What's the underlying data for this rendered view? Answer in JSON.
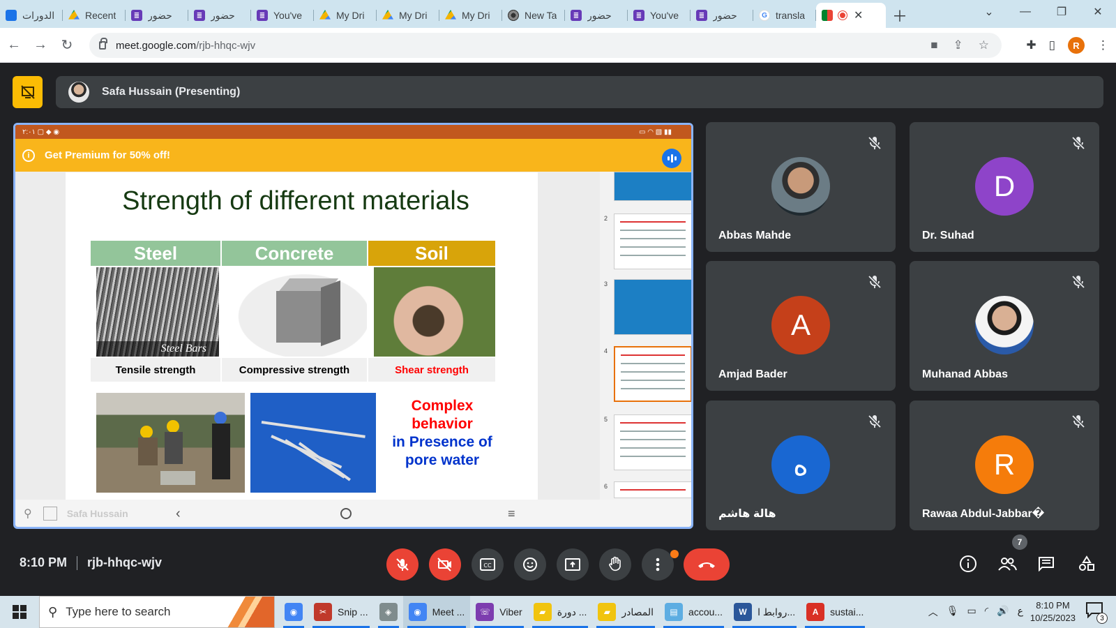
{
  "browser": {
    "tabs": [
      {
        "label": "الدورات",
        "icon": "contacts-icon"
      },
      {
        "label": "Recent",
        "icon": "drive-icon"
      },
      {
        "label": "حضور",
        "icon": "forms-icon"
      },
      {
        "label": "حضور",
        "icon": "forms-icon"
      },
      {
        "label": "You've",
        "icon": "forms-icon"
      },
      {
        "label": "My Dri",
        "icon": "drive-icon"
      },
      {
        "label": "My Dri",
        "icon": "drive-icon"
      },
      {
        "label": "My Dri",
        "icon": "drive-icon"
      },
      {
        "label": "New Ta",
        "icon": "chrome-icon"
      },
      {
        "label": "حضور",
        "icon": "forms-icon"
      },
      {
        "label": "You've",
        "icon": "forms-icon"
      },
      {
        "label": "حضور",
        "icon": "forms-icon"
      },
      {
        "label": "transla",
        "icon": "google-icon"
      }
    ],
    "url_host": "meet.google.com",
    "url_path": "/rjb-hhqc-wjv",
    "profile_initial": "R"
  },
  "meet": {
    "presenter_label": "Safa Hussain (Presenting)",
    "premium_banner": "Get Premium for 50% off!",
    "presenter_watermark": "Safa Hussain",
    "slide": {
      "title": "Strength of different materials",
      "materials": [
        {
          "name": "Steel",
          "strength": "Tensile strength",
          "header_color": "#93c59a",
          "label_color": "#000000",
          "image_caption": "Steel Bars"
        },
        {
          "name": "Concrete",
          "strength": "Compressive strength",
          "header_color": "#93c59a",
          "label_color": "#000000"
        },
        {
          "name": "Soil",
          "strength": "Shear strength",
          "header_color": "#d8a40a",
          "label_color": "#ff0000"
        }
      ],
      "complex_red": "Complex behavior",
      "complex_blue": "in Presence of pore water"
    },
    "thumbnails": [
      {
        "num": "",
        "selected": false
      },
      {
        "num": "2",
        "selected": false
      },
      {
        "num": "3",
        "selected": false
      },
      {
        "num": "4",
        "selected": true
      },
      {
        "num": "5",
        "selected": false
      },
      {
        "num": "6",
        "selected": false
      }
    ],
    "participants": [
      {
        "name": "Abbas Mahde",
        "initial": "",
        "avatar_color": "",
        "photo": "photo1"
      },
      {
        "name": "Dr. Suhad",
        "initial": "D",
        "avatar_color": "#8e44c9",
        "photo": ""
      },
      {
        "name": "Amjad Bader",
        "initial": "A",
        "avatar_color": "#c5401a",
        "photo": ""
      },
      {
        "name": "Muhanad Abbas",
        "initial": "",
        "avatar_color": "",
        "photo": "photo2"
      },
      {
        "name": "هالة هاشم",
        "initial": "ه",
        "avatar_color": "#1967d2",
        "photo": ""
      },
      {
        "name": "Rawaa Abdul-Jabbar�",
        "initial": "R",
        "avatar_color": "#f57c0b",
        "photo": ""
      }
    ],
    "time": "8:10 PM",
    "meeting_code": "rjb-hhqc-wjv",
    "people_count": "7"
  },
  "taskbar": {
    "search_placeholder": "Type here to search",
    "items": [
      {
        "label": "",
        "icon": "chrome-icon",
        "color": "#4285f4"
      },
      {
        "label": "Snip ...",
        "icon": "snip-icon",
        "color": "#c0392b"
      },
      {
        "label": "",
        "icon": "app-icon",
        "color": "#7f8c8d"
      },
      {
        "label": "Meet ...",
        "icon": "chrome-icon",
        "color": "#4285f4"
      },
      {
        "label": "Viber",
        "icon": "viber-icon",
        "color": "#7d3daf"
      },
      {
        "label": "دورة ...",
        "icon": "folder-icon",
        "color": "#f1c40f"
      },
      {
        "label": "المصادر",
        "icon": "folder-icon",
        "color": "#f1c40f"
      },
      {
        "label": "accou...",
        "icon": "notebook-icon",
        "color": "#5dade2"
      },
      {
        "label": "روابط ا...",
        "icon": "word-icon",
        "color": "#2b579a"
      },
      {
        "label": "sustai...",
        "icon": "pdf-icon",
        "color": "#d93025"
      }
    ],
    "lang": "ع",
    "clock_time": "8:10 PM",
    "clock_date": "10/25/2023",
    "notification_count": "3"
  }
}
